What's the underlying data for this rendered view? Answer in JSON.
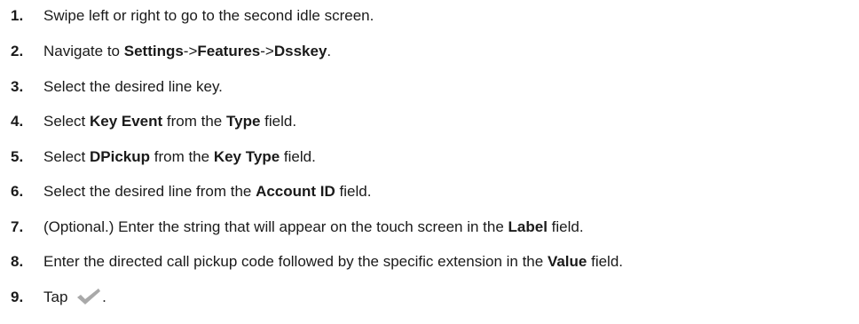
{
  "steps": [
    {
      "number": "1.",
      "parts": [
        {
          "text": "Swipe left or right to go to the second idle screen."
        }
      ]
    },
    {
      "number": "2.",
      "parts": [
        {
          "text": "Navigate to "
        },
        {
          "text": "Settings",
          "bold": true
        },
        {
          "text": "->"
        },
        {
          "text": "Features",
          "bold": true
        },
        {
          "text": "->"
        },
        {
          "text": "Dsskey",
          "bold": true
        },
        {
          "text": "."
        }
      ]
    },
    {
      "number": "3.",
      "parts": [
        {
          "text": "Select the desired line key."
        }
      ]
    },
    {
      "number": "4.",
      "parts": [
        {
          "text": "Select "
        },
        {
          "text": "Key Event",
          "bold": true
        },
        {
          "text": " from the "
        },
        {
          "text": "Type",
          "bold": true
        },
        {
          "text": " field."
        }
      ]
    },
    {
      "number": "5.",
      "parts": [
        {
          "text": "Select "
        },
        {
          "text": "DPickup",
          "bold": true
        },
        {
          "text": " from the "
        },
        {
          "text": "Key Type",
          "bold": true
        },
        {
          "text": " field."
        }
      ]
    },
    {
      "number": "6.",
      "parts": [
        {
          "text": "Select the desired line from the "
        },
        {
          "text": "Account ID",
          "bold": true
        },
        {
          "text": " field."
        }
      ]
    },
    {
      "number": "7.",
      "parts": [
        {
          "text": "(Optional.) Enter the string that will appear on the touch screen in the "
        },
        {
          "text": "Label",
          "bold": true
        },
        {
          "text": " field."
        }
      ]
    },
    {
      "number": "8.",
      "parts": [
        {
          "text": "Enter the directed call pickup code followed by the specific extension in the "
        },
        {
          "text": "Value",
          "bold": true
        },
        {
          "text": " field."
        }
      ]
    },
    {
      "number": "9.",
      "parts": [
        {
          "text": "Tap "
        },
        {
          "icon": "checkmark-icon"
        },
        {
          "text": "."
        }
      ]
    }
  ],
  "colors": {
    "text": "#1a1a1a",
    "checkmark": "#a9a9a9"
  }
}
